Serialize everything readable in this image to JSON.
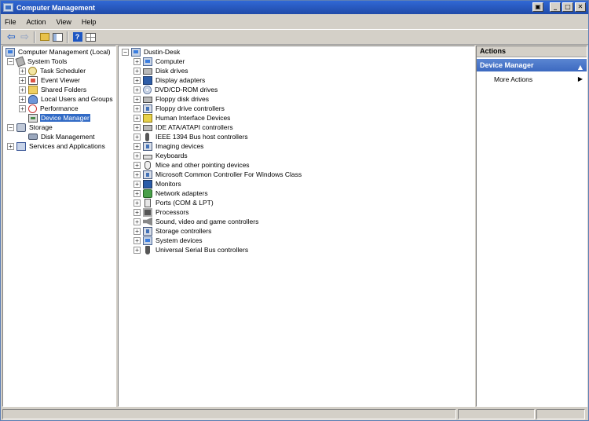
{
  "window": {
    "title": "Computer Management"
  },
  "window_buttons": [
    "▣",
    "_",
    "□",
    "✕"
  ],
  "menu": [
    "File",
    "Action",
    "View",
    "Help"
  ],
  "toolbar": {
    "buttons": [
      "back-arrow-icon",
      "forward-arrow-icon",
      "up-folder-icon",
      "show-hide-tree-icon",
      "help-icon",
      "properties-icon"
    ]
  },
  "left_tree": {
    "root": "Computer Management (Local)",
    "system_tools": "System Tools",
    "task_scheduler": "Task Scheduler",
    "event_viewer": "Event Viewer",
    "shared_folders": "Shared Folders",
    "local_users": "Local Users and Groups",
    "performance": "Performance",
    "device_manager": "Device Manager",
    "storage": "Storage",
    "disk_management": "Disk Management",
    "services": "Services and Applications"
  },
  "device_tree": {
    "root": "Dustin-Desk",
    "devices": [
      "Computer",
      "Disk drives",
      "Display adapters",
      "DVD/CD-ROM drives",
      "Floppy disk drives",
      "Floppy drive controllers",
      "Human Interface Devices",
      "IDE ATA/ATAPI controllers",
      "IEEE 1394 Bus host controllers",
      "Imaging devices",
      "Keyboards",
      "Mice and other pointing devices",
      "Microsoft Common Controller For Windows Class",
      "Monitors",
      "Network adapters",
      "Ports (COM & LPT)",
      "Processors",
      "Sound, video and game controllers",
      "Storage controllers",
      "System devices",
      "Universal Serial Bus controllers"
    ]
  },
  "actions": {
    "header": "Actions",
    "section": "Device Manager",
    "collapse_glyph": "▲",
    "more_actions": "More Actions",
    "more_arrow": "▶"
  }
}
